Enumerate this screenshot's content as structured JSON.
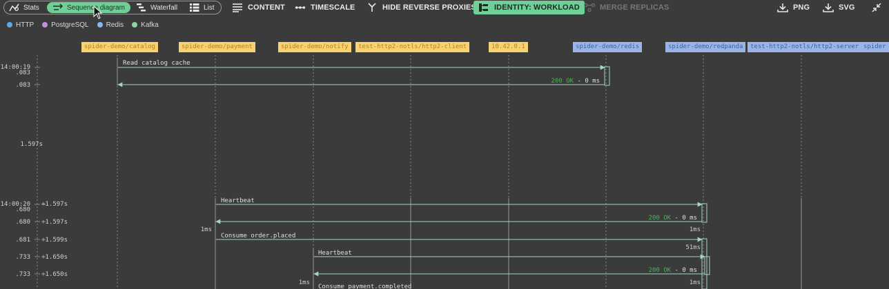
{
  "toolbar": {
    "views": [
      {
        "label": "Stats",
        "icon": "stats-icon",
        "active": false
      },
      {
        "label": "Sequence diagram",
        "icon": "sequence-icon",
        "active": true
      },
      {
        "label": "Waterfall",
        "icon": "waterfall-icon",
        "active": false
      },
      {
        "label": "List",
        "icon": "list-icon",
        "active": false
      }
    ],
    "buttons": [
      {
        "label": "CONTENT",
        "icon": "content-icon",
        "state": "normal"
      },
      {
        "label": "TIMESCALE",
        "icon": "timescale-icon",
        "state": "normal"
      },
      {
        "label": "HIDE REVERSE PROXIES",
        "icon": "proxy-icon",
        "state": "normal"
      },
      {
        "label": "IDENTITY: WORKLOAD",
        "icon": "identity-icon",
        "state": "on"
      },
      {
        "label": "MERGE REPLICAS",
        "icon": "merge-icon",
        "state": "disabled"
      }
    ],
    "export_png": "PNG",
    "export_svg": "SVG"
  },
  "legend": [
    {
      "label": "HTTP",
      "color": "#5aa9e6"
    },
    {
      "label": "PostgreSQL",
      "color": "#c48fd6"
    },
    {
      "label": "Redis",
      "color": "#8ab4f8"
    },
    {
      "label": "Kafka",
      "color": "#8fd3a8"
    }
  ],
  "participants": [
    {
      "label": "spider-demo/catalog",
      "style": "yellow"
    },
    {
      "label": "spider-demo/payment",
      "style": "yellow"
    },
    {
      "label": "spider-demo/notify",
      "style": "yellow"
    },
    {
      "label": "test-http2-notls/http2-client",
      "style": "yellow"
    },
    {
      "label": "10.42.0.1",
      "style": "yellow"
    },
    {
      "label": "spider-demo/redis",
      "style": "blue"
    },
    {
      "label": "spider-demo/redpanda",
      "style": "blue"
    },
    {
      "label": "test-http2-notls/http2-server",
      "style": "blue"
    },
    {
      "label": "spider",
      "style": "blue"
    }
  ],
  "time_labels": [
    {
      "text": "14:00:19"
    },
    {
      "text": ".083"
    },
    {
      "text": ".083"
    },
    {
      "text": "1.597s"
    },
    {
      "text": "14:00:20"
    },
    {
      "text": "+1.597s"
    },
    {
      "text": ".680"
    },
    {
      "text": ".680"
    },
    {
      "text": "+1.597s"
    },
    {
      "text": ".681"
    },
    {
      "text": "+1.599s"
    },
    {
      "text": ".733"
    },
    {
      "text": "+1.650s"
    },
    {
      "text": ".733"
    },
    {
      "text": "+1.650s"
    }
  ],
  "messages": [
    {
      "label": "Read catalog cache"
    },
    {
      "status": "200 OK",
      "sep": " - ",
      "duration": "0 ms"
    },
    {
      "label": "Heartbeat"
    },
    {
      "status": "200 OK",
      "sep": " - ",
      "duration": "0 ms"
    },
    {
      "label": "Consume order.placed"
    },
    {
      "label": "Heartbeat"
    },
    {
      "status": "200 OK",
      "sep": " - ",
      "duration": "0 ms"
    },
    {
      "label": "Consume payment.completed"
    }
  ],
  "gap_labels": [
    {
      "text": "1ms"
    },
    {
      "text": "1ms"
    },
    {
      "text": "51ms"
    },
    {
      "text": "1ms"
    },
    {
      "text": "1ms"
    }
  ]
}
